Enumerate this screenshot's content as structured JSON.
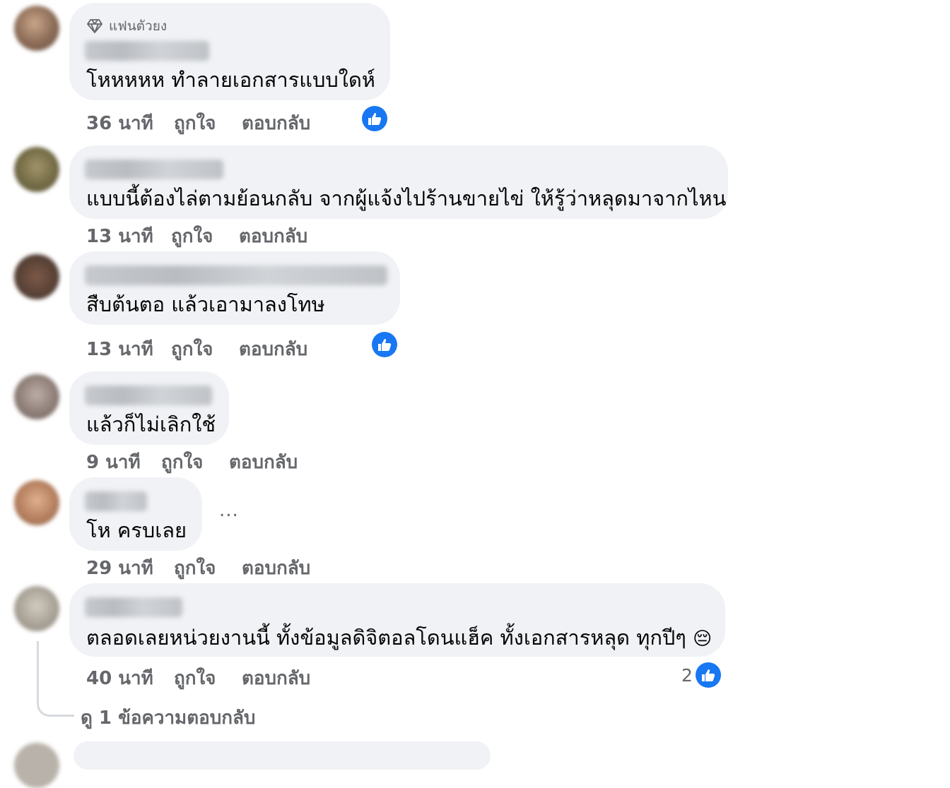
{
  "comments": [
    {
      "badge": "แฟนตัวยง",
      "text": "โหหหหห ทำลายเอกสารแบบใดห์",
      "time": "36 นาที",
      "like": "ถูกใจ",
      "reply": "ตอบกลับ",
      "reaction": "like-icon"
    },
    {
      "text": "แบบนี้ต้องไล่ตามย้อนกลับ จากผู้แจ้งไปร้านขายไข่ ให้รู้ว่าหลุดมาจากไหน",
      "time": "13 นาที",
      "like": "ถูกใจ",
      "reply": "ตอบกลับ"
    },
    {
      "text": "สืบต้นตอ แล้วเอามาลงโทษ",
      "time": "13 นาที",
      "like": "ถูกใจ",
      "reply": "ตอบกลับ",
      "reaction": "like-icon"
    },
    {
      "text": "แล้วก็ไม่เลิกใช้",
      "time": "9 นาที",
      "like": "ถูกใจ",
      "reply": "ตอบกลับ"
    },
    {
      "text": "โห ครบเลย",
      "time": "29 นาที",
      "like": "ถูกใจ",
      "reply": "ตอบกลับ",
      "more": "..."
    },
    {
      "text": "ตลอดเลยหน่วยงานนี้ ทั้งข้อมูลดิจิตอลโดนแฮ็ค ทั้งเอกสารหลุด ทุกปีๆ",
      "emoji": "😔",
      "time": "40 นาที",
      "like": "ถูกใจ",
      "reply": "ตอบกลับ",
      "reaction_count": "2",
      "reaction": "like-icon"
    }
  ],
  "view_replies": "ดู 1 ข้อความตอบกลับ",
  "colors": {
    "bubble": "#f0f2f5",
    "meta": "#65676b",
    "like_blue": "#1877f2"
  }
}
